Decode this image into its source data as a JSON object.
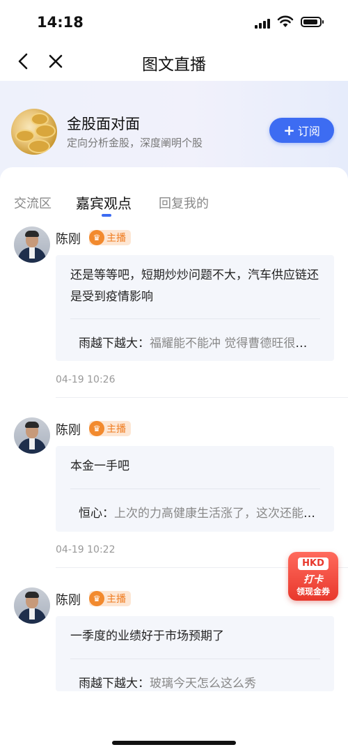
{
  "status_bar": {
    "time": "14:18"
  },
  "nav": {
    "title": "图文直播"
  },
  "channel": {
    "name": "金股面对面",
    "description": "定向分析金股，深度阐明个股",
    "subscribe_plus": "+",
    "subscribe_label": "订阅"
  },
  "tabs": [
    {
      "label": "交流区"
    },
    {
      "label": "嘉宾观点",
      "active": true
    },
    {
      "label": "回复我的"
    }
  ],
  "posts": [
    {
      "author": "陈刚",
      "badge": "主播",
      "message": "还是等等吧，短期炒炒问题不大，汽车供应链还是受到疫情影响",
      "reply_user": "雨越下越大：",
      "reply_text": "福耀能不能冲  觉得曹德旺很看好",
      "time": "04-19 10:26"
    },
    {
      "author": "陈刚",
      "badge": "主播",
      "message": "本金一手吧",
      "reply_user": "恒心：",
      "reply_text": "上次的力高健康生活涨了，这次还能参与吗",
      "time": "04-19 10:22"
    },
    {
      "author": "陈刚",
      "badge": "主播",
      "message": "一季度的业绩好于市场预期了",
      "reply_user": "雨越下越大：",
      "reply_text": "玻璃今天怎么这么秀",
      "time": ""
    }
  ],
  "promo": {
    "tag": "HKD",
    "main": "打卡",
    "sub": "领现金券"
  },
  "colors": {
    "accent": "#3d6cf2",
    "badge_orange": "#ef7c20",
    "promo_red": "#e8382c"
  }
}
